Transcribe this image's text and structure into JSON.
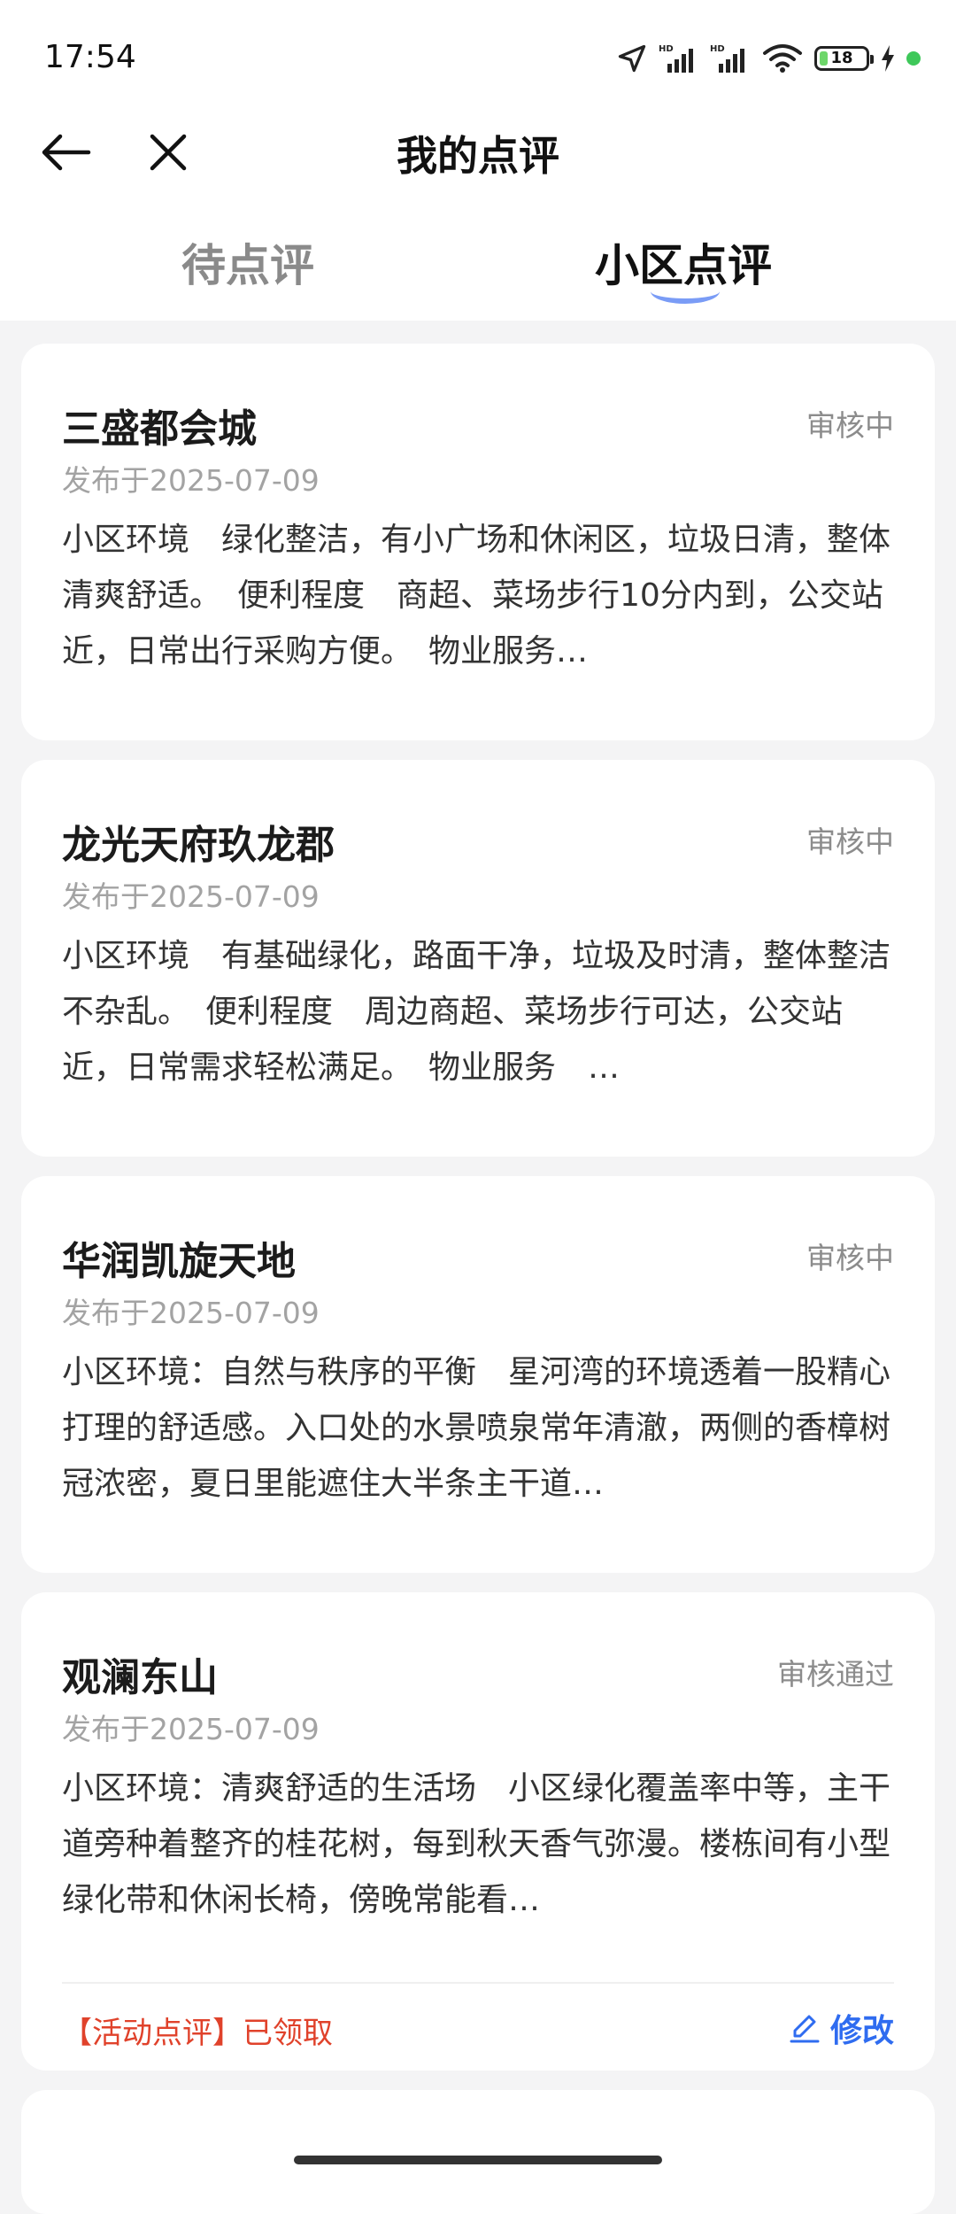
{
  "status_bar": {
    "time": "17:54",
    "battery_level": 18,
    "battery_text": "18",
    "icons": [
      "location-icon",
      "signal-hd-1-icon",
      "signal-hd-2-icon",
      "wifi-icon",
      "battery-icon",
      "charging-icon"
    ]
  },
  "header": {
    "title": "我的点评"
  },
  "tabs": [
    {
      "label": "待点评",
      "active": false
    },
    {
      "label": "小区点评",
      "active": true
    }
  ],
  "cards": [
    {
      "title": "三盛都会城",
      "status": "审核中",
      "date": "发布于2025-07-09",
      "body": "小区环境　绿化整洁，有小广场和休闲区，垃圾日清，整体清爽舒适。　便利程度　商超、菜场步行10分内到，公交站近，日常出行采购方便。　物业服务…"
    },
    {
      "title": "龙光天府玖龙郡",
      "status": "审核中",
      "date": "发布于2025-07-09",
      "body": "小区环境　有基础绿化，路面干净，垃圾及时清，整体整洁不杂乱。　便利程度　周边商超、菜场步行可达，公交站近，日常需求轻松满足。　物业服务　…"
    },
    {
      "title": "华润凯旋天地",
      "status": "审核中",
      "date": "发布于2025-07-09",
      "body": "小区环境：自然与秩序的平衡　星河湾的环境透着一股精心打理的舒适感。入口处的水景喷泉常年清澈，两侧的香樟树冠浓密，夏日里能遮住大半条主干道…"
    },
    {
      "title": "观澜东山",
      "status": "审核通过",
      "date": "发布于2025-07-09",
      "body": "小区环境：清爽舒适的生活场　小区绿化覆盖率中等，主干道旁种着整齐的桂花树，每到秋天香气弥漫。楼栋间有小型绿化带和休闲长椅，傍晚常能看…",
      "activity": "【活动点评】已领取",
      "edit_label": "修改"
    }
  ],
  "colors": {
    "accent_blue": "#2f6cf0",
    "activity_red": "#e0422b",
    "background": "#f4f4f5"
  }
}
